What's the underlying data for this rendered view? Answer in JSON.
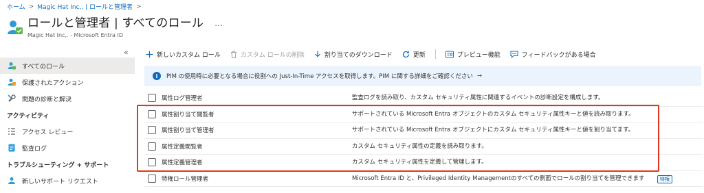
{
  "breadcrumb": {
    "items": [
      "ホーム",
      "Magic Hat Inc,. | ロールと管理者"
    ]
  },
  "header": {
    "title": "ロールと管理者 | すべてのロール",
    "more": "…",
    "subtitle": "Magic Hat Inc,. - Microsoft Entra ID"
  },
  "sidebar": {
    "collapse": "«",
    "items": [
      {
        "label": "すべてのロール",
        "icon": "roles-icon",
        "selected": true
      },
      {
        "label": "保護されたアクション",
        "icon": "protected-actions-icon"
      },
      {
        "label": "問題の診断と解決",
        "icon": "wrench-icon"
      }
    ],
    "section_activity": "アクティビティ",
    "activity_items": [
      {
        "label": "アクセス レビュー",
        "icon": "access-review-icon"
      },
      {
        "label": "監査ログ",
        "icon": "audit-log-icon"
      }
    ],
    "section_support": "トラブルシューティング + サポート",
    "support_items": [
      {
        "label": "新しいサポート リクエスト",
        "icon": "support-request-icon"
      }
    ]
  },
  "toolbar": {
    "new_role": "新しいカスタム ロール",
    "delete_role": "カスタム ロールの削除",
    "download": "割り当てのダウンロード",
    "refresh": "更新",
    "preview": "プレビュー機能",
    "feedback": "フィードバックがある場合"
  },
  "banner": {
    "text": "PIM の使用時に必要となる場合に役割への Just-In-Time アクセスを取得します。PIM に関する詳細をご確認ください",
    "arrow": "→"
  },
  "roles": [
    {
      "name": "属性ログ管理者",
      "desc": "監査ログを読み取り、カスタム セキュリティ属性に関連するイベントの診断設定を構成します。"
    },
    {
      "name": "属性割り当て閲覧者",
      "desc": "サポートされている Microsoft Entra オブジェクトのカスタム セキュリティ属性キーと値を読み取ります。"
    },
    {
      "name": "属性割り当て管理者",
      "desc": "サポートされている Microsoft Entra オブジェクトにカスタム セキュリティ属性キーと値を割り当てます。"
    },
    {
      "name": "属性定義閲覧者",
      "desc": "カスタム セキュリティ属性の定義を読み取ります。"
    },
    {
      "name": "属性定義管理者",
      "desc": "カスタム セキュリティ属性を定義して管理します。"
    },
    {
      "name": "特権ロール管理者",
      "desc": "Microsoft Entra ID と、Privileged Identity Managementのすべての側面でロールの割り当てを管理できます",
      "badge": "特権"
    }
  ],
  "colors": {
    "accent": "#0f6cbd",
    "highlight": "#e0361c",
    "banner_bg": "#ebf3fc",
    "selected_bg": "#edebe9"
  }
}
